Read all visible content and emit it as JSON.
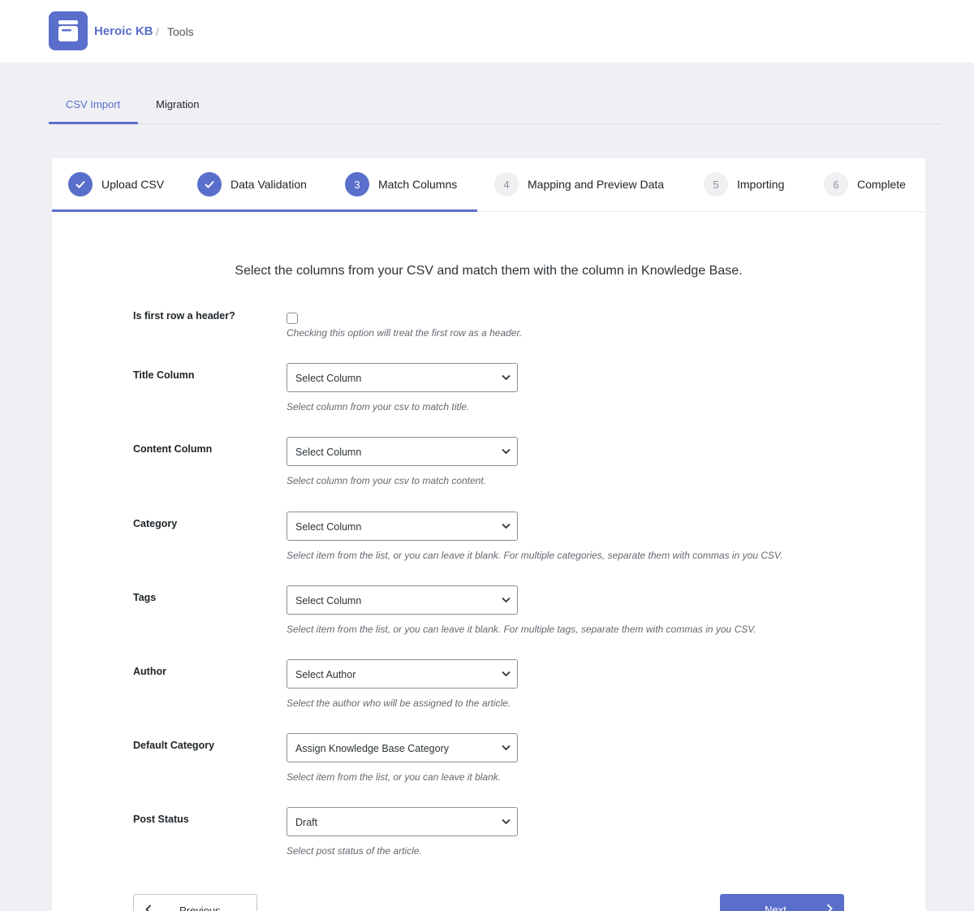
{
  "header": {
    "brand": "Heroic KB",
    "separator": "/",
    "page": "Tools"
  },
  "tabs": [
    {
      "label": "CSV Import",
      "active": true
    },
    {
      "label": "Migration",
      "active": false
    }
  ],
  "steps": [
    {
      "number": "1",
      "label": "Upload CSV",
      "state": "done"
    },
    {
      "number": "2",
      "label": "Data Validation",
      "state": "done"
    },
    {
      "number": "3",
      "label": "Match Columns",
      "state": "current"
    },
    {
      "number": "4",
      "label": "Mapping and Preview Data",
      "state": "todo"
    },
    {
      "number": "5",
      "label": "Importing",
      "state": "todo"
    },
    {
      "number": "6",
      "label": "Complete",
      "state": "todo"
    }
  ],
  "intro": "Select the columns from your CSV and match them with the column in Knowledge Base.",
  "form": {
    "header_row": {
      "label": "Is first row a header?",
      "checked": false,
      "help": "Checking this option will treat the first row as a header."
    },
    "title": {
      "label": "Title Column",
      "value": "Select Column",
      "help": "Select column from your csv to match title."
    },
    "content": {
      "label": "Content Column",
      "value": "Select Column",
      "help": "Select column from your csv to match content."
    },
    "category": {
      "label": "Category",
      "value": "Select Column",
      "help": "Select item from the list, or you can leave it blank. For multiple categories, separate them with commas in you CSV."
    },
    "tags": {
      "label": "Tags",
      "value": "Select Column",
      "help": "Select item from the list, or you can leave it blank. For multiple tags, separate them with commas in you CSV."
    },
    "author": {
      "label": "Author",
      "value": "Select Author",
      "help": "Select the author who will be assigned to the article."
    },
    "default_category": {
      "label": "Default Category",
      "value": "Assign Knowledge Base Category",
      "help": "Select item from the list, or you can leave it blank."
    },
    "post_status": {
      "label": "Post Status",
      "value": "Draft",
      "help": "Select post status of the article."
    }
  },
  "buttons": {
    "previous": "Previous",
    "next": "Next"
  },
  "colors": {
    "accent": "#5a6fcb",
    "background": "#f0f0f4"
  },
  "icons": {
    "logo": "kb-book-icon",
    "done": "check-icon",
    "select": "chevron-down-icon",
    "previous": "chevron-left-icon",
    "next": "chevron-right-icon"
  }
}
